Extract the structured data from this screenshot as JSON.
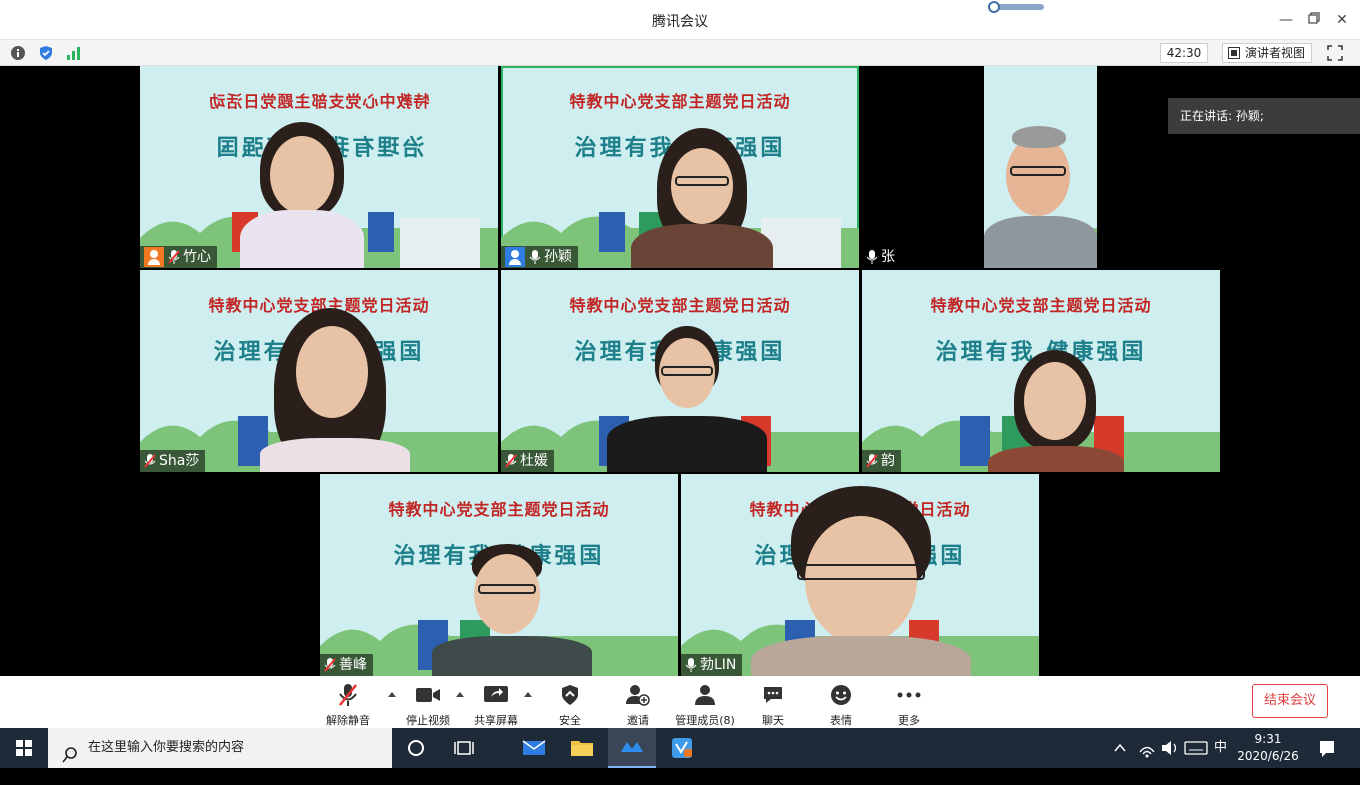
{
  "window": {
    "title": "腾讯会议",
    "minimize_icon": "minimize-icon",
    "maximize_icon": "restore-icon",
    "close_icon": "close-icon"
  },
  "infobar": {
    "timer": "42:30",
    "speaker_view_label": "演讲者视图"
  },
  "talking_indicator": "正在讲话: 孙颖;",
  "banner": {
    "line1": "特教中心党支部主题党日活动",
    "line2": "治理有我 健康强国"
  },
  "participants": [
    {
      "name": "竹心",
      "host": true,
      "host_color": "#f07a23",
      "muted": true
    },
    {
      "name": "孙颖",
      "host": true,
      "host_color": "#2f7de1",
      "muted": false,
      "active": true
    },
    {
      "name": "张",
      "host": false,
      "muted": false
    },
    {
      "name": "Sha莎",
      "host": false,
      "muted": true
    },
    {
      "name": "杜媛",
      "host": false,
      "muted": true
    },
    {
      "name": "韵",
      "host": false,
      "muted": true
    },
    {
      "name": "善峰",
      "host": false,
      "muted": true
    },
    {
      "name": "勃LIN",
      "host": false,
      "muted": false
    }
  ],
  "toolbar": {
    "unmute": "解除静音",
    "stop_video": "停止视频",
    "share_screen": "共享屏幕",
    "security": "安全",
    "invite": "邀请",
    "manage_members": "管理成员(8)",
    "chat": "聊天",
    "reactions": "表情",
    "more": "更多",
    "end_meeting": "结束会议"
  },
  "taskbar": {
    "search_placeholder": "在这里输入你要搜索的内容",
    "ime": "中",
    "time": "9:31",
    "date": "2020/6/26"
  }
}
